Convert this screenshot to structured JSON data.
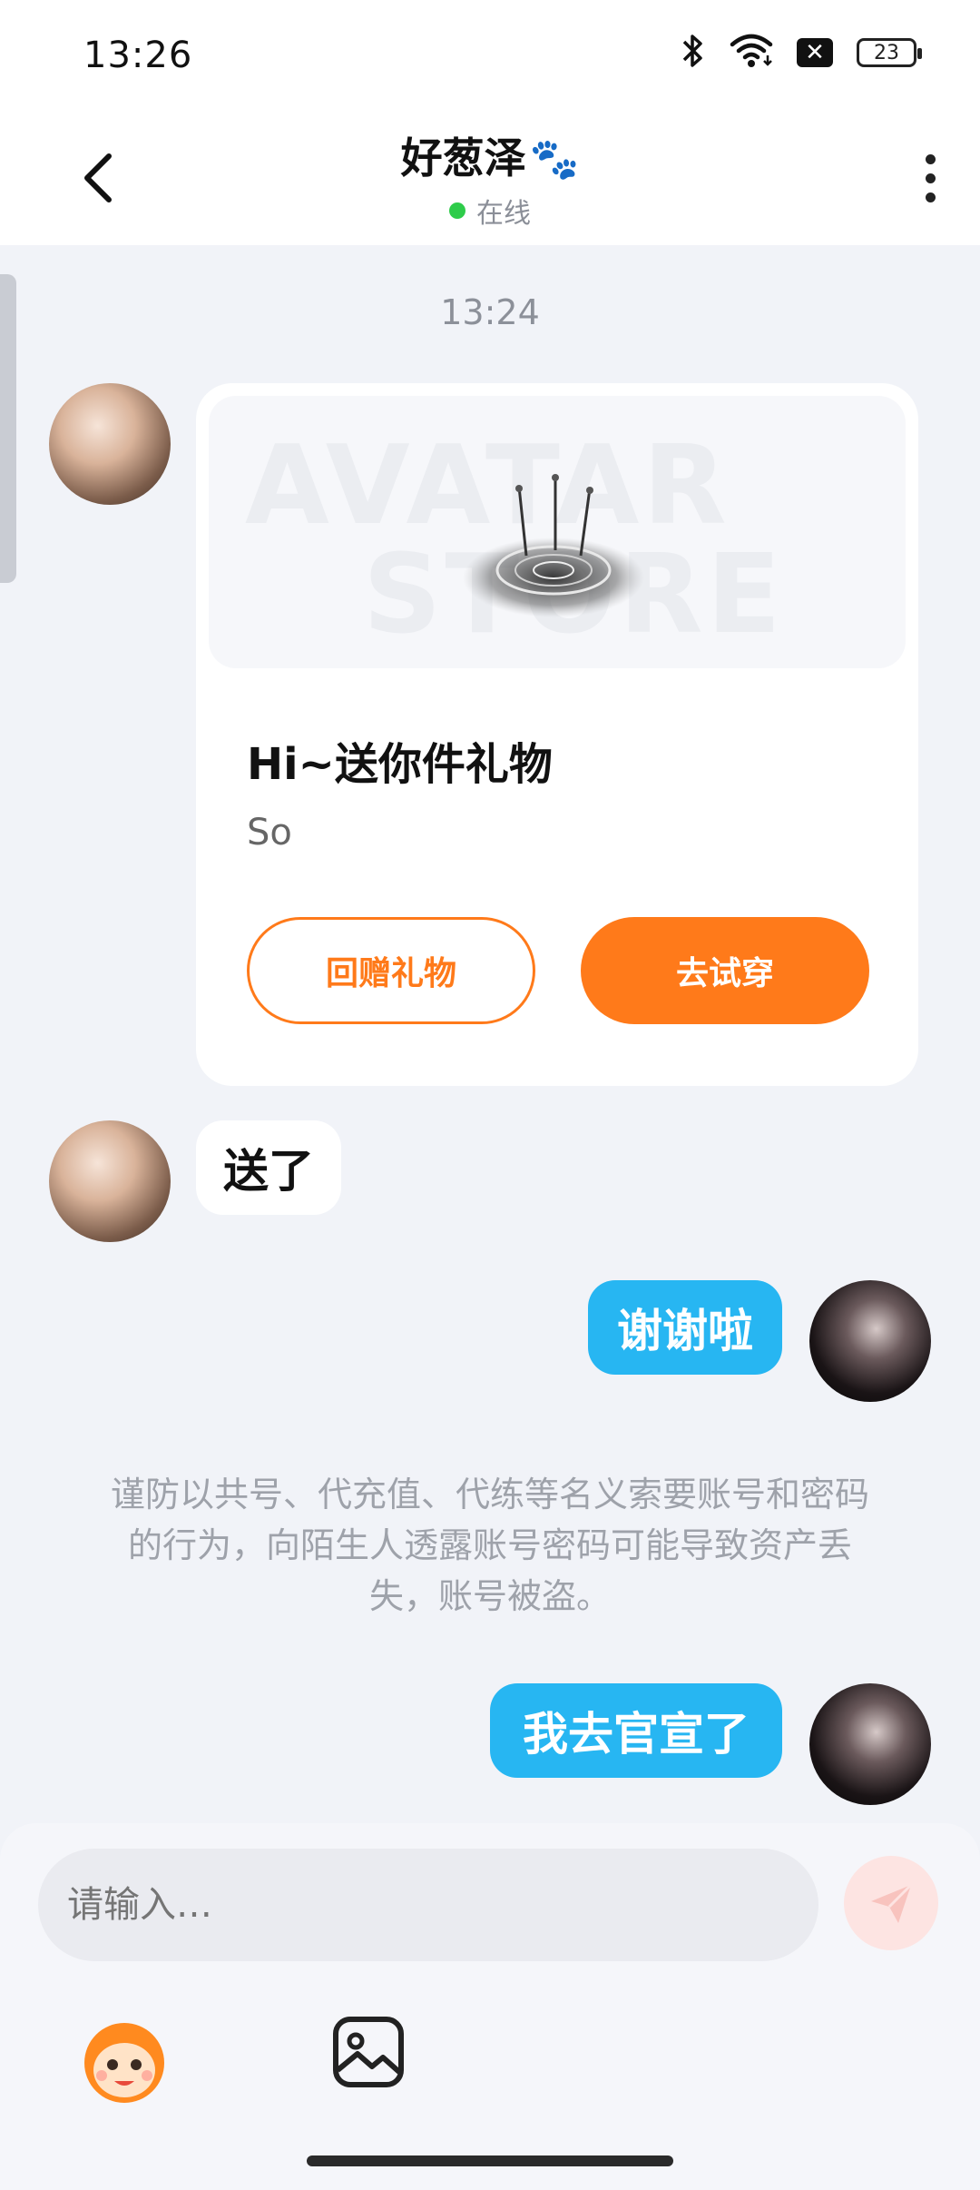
{
  "status_bar": {
    "time": "13:26",
    "battery": "23",
    "icons": [
      "bluetooth-icon",
      "wifi-icon",
      "sim-off-icon",
      "battery-icon"
    ]
  },
  "header": {
    "contact_name": "好葱泽",
    "name_suffix": "🐾",
    "status": "在线",
    "status_color": "#2ecc4a"
  },
  "chat": {
    "timestamp": "13:24",
    "gift_card": {
      "watermark_line1": "AVATAR",
      "watermark_line2": "STORE",
      "title": "Hi~送你件礼物",
      "subtitle": "So",
      "return_gift_label": "回赠礼物",
      "try_on_label": "去试穿"
    },
    "messages": [
      {
        "side": "left",
        "text": "送了"
      },
      {
        "side": "right",
        "text": "谢谢啦"
      },
      {
        "side": "right",
        "text": "我去官宣了"
      }
    ],
    "notice": "谨防以共号、代充值、代练等名义索要账号和密码的行为，向陌生人透露账号密码可能导致资产丢失，账号被盗。"
  },
  "composer": {
    "placeholder": "请输入…",
    "tools": [
      "emoji-mascot-icon",
      "image-icon"
    ]
  },
  "colors": {
    "accent_orange": "#ff7a1a",
    "bubble_blue": "#27b6f2",
    "background": "#f1f3f8"
  }
}
